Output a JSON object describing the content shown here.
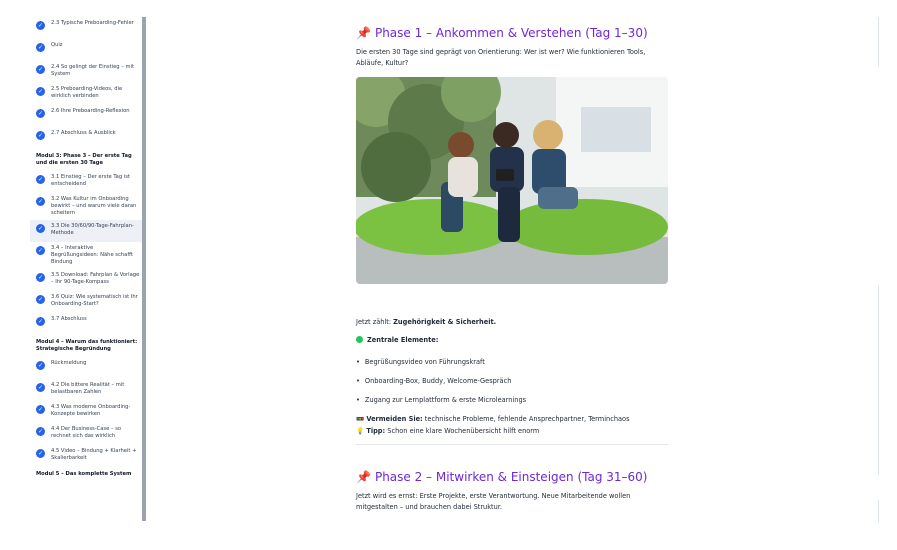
{
  "sidebar": {
    "entries": [
      {
        "kind": "lesson",
        "label": "2.3 Typische Preboarding-Fehler"
      },
      {
        "kind": "lesson",
        "label": "Quiz"
      },
      {
        "kind": "lesson",
        "label": "2.4 So gelingt der Einstieg – mit System"
      },
      {
        "kind": "lesson",
        "label": "2.5 Preboarding-Videos, die wirklich verbinden"
      },
      {
        "kind": "lesson",
        "label": "2.6 Ihre Preboarding-Reflexion"
      },
      {
        "kind": "lesson",
        "label": "2.7 Abschluss & Ausblick"
      },
      {
        "kind": "module",
        "label": "Modul 3: Phase 3 – Der erste Tag und die ersten 30 Tage"
      },
      {
        "kind": "lesson",
        "label": "3.1 Einstieg – Der erste Tag ist entscheidend"
      },
      {
        "kind": "lesson",
        "label": "3.2 Was Kultur im Onboarding bewirkt – und warum viele daran scheitern"
      },
      {
        "kind": "lesson",
        "label": "3.3 Die 30/60/90-Tage-Fahrplan-Methode",
        "active": true
      },
      {
        "kind": "lesson",
        "label": "3.4 – Interaktive Begrüßungsideen: Nähe schafft Bindung"
      },
      {
        "kind": "lesson",
        "label": "3.5 Download: Fahrplan & Vorlage – Ihr 90-Tage-Kompass"
      },
      {
        "kind": "lesson",
        "label": "3.6 Quiz: Wie systematisch ist Ihr Onboarding-Start?"
      },
      {
        "kind": "lesson",
        "label": "3.7 Abschluss"
      },
      {
        "kind": "module",
        "label": "Modul 4 – Warum das funktioniert: Strategische Begründung"
      },
      {
        "kind": "lesson",
        "label": "Rückmeldung"
      },
      {
        "kind": "lesson",
        "label": "4.2 Die bittere Realität – mit belastbaren Zahlen"
      },
      {
        "kind": "lesson",
        "label": "4.3 Was moderne Onboarding-Konzepte bewirken"
      },
      {
        "kind": "lesson",
        "label": "4.4 Der Business-Case – so rechnet sich das wirklich"
      },
      {
        "kind": "lesson",
        "label": "4.5 Video – Bindung + Klarheit + Skalierbarkeit"
      },
      {
        "kind": "module",
        "label": "Modul 5 – Das komplette System"
      }
    ]
  },
  "phase1": {
    "pin": "📌",
    "title": "Phase 1 – Ankommen & Verstehen (Tag 1–30)",
    "intro": "Die ersten 30 Tage sind geprägt von Orientierung: Wer ist wer? Wie funktionieren Tools, Abläufe, Kultur?",
    "counts_prefix": "Jetzt zählt: ",
    "counts_bold": "Zugehörigkeit & Sicherheit.",
    "elements_heading": "Zentrale Elemente:",
    "bullets": [
      "Begrüßungsvideo von Führungskraft",
      "Onboarding-Box, Buddy, Welcome-Gespräch",
      "Zugang zur Lernplattform & erste Microlearnings"
    ],
    "avoid_icon": "🚥",
    "avoid_label": "Vermeiden Sie:",
    "avoid_text": " technische Probleme, fehlende Ansprechpartner, Terminchaos",
    "tip_icon": "💡",
    "tip_label": "Tipp:",
    "tip_text": " Schon eine klare Wochenübersicht hilft enorm"
  },
  "phase2": {
    "pin": "📌",
    "title": "Phase 2 – Mitwirken & Einsteigen (Tag 31–60)",
    "intro": "Jetzt wird es ernst: Erste Projekte, erste Verantwortung. Neue Mitarbeitende wollen mitgestalten – und brauchen dabei Struktur."
  },
  "colors": {
    "accent": "#6d28d9",
    "check": "#2563eb",
    "active_row": "#eef0f8",
    "dot": "#22c55e"
  }
}
